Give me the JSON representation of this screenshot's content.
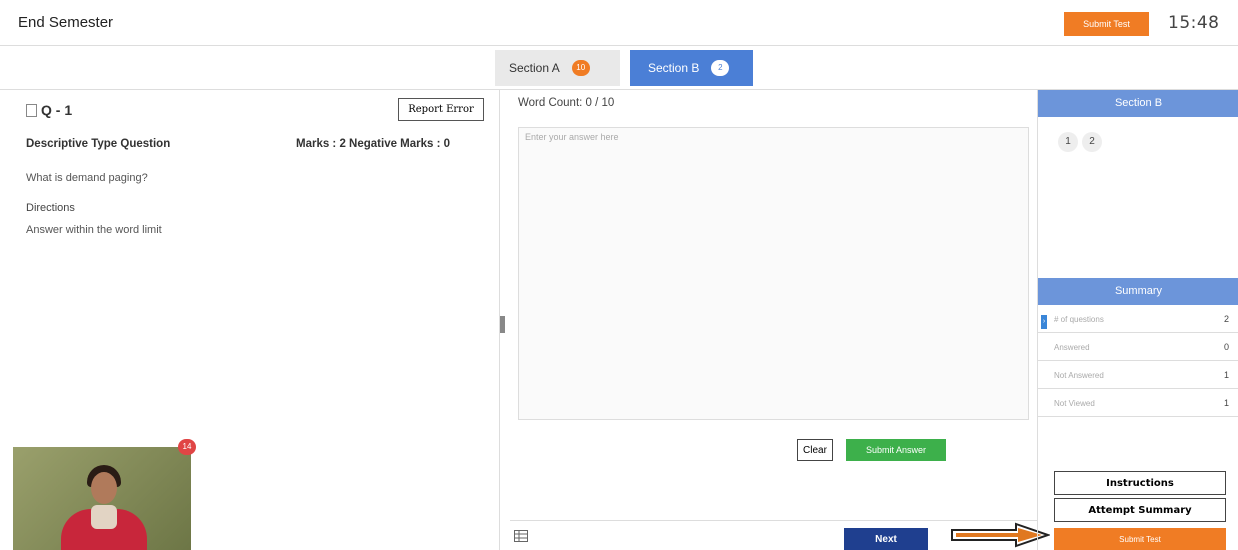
{
  "header": {
    "title": "End Semester",
    "submit_label": "Submit Test",
    "timer": "15:48"
  },
  "tabs": [
    {
      "label": "Section A",
      "badge": "10"
    },
    {
      "label": "Section B",
      "badge": "2"
    }
  ],
  "question": {
    "number": "Q - 1",
    "report_label": "Report Error",
    "type": "Descriptive Type Question",
    "marks": "Marks : 2  Negative Marks : 0",
    "text": "What is demand paging?",
    "directions_title": "Directions",
    "directions_text": "Answer within the word limit"
  },
  "webcam": {
    "badge": "14"
  },
  "answer": {
    "word_count": "Word Count: 0 / 10",
    "placeholder": "Enter your answer here",
    "clear_label": "Clear",
    "submit_label": "Submit Answer",
    "next_label": "Next"
  },
  "side": {
    "section_title": "Section B",
    "question_numbers": [
      "1",
      "2"
    ],
    "summary_title": "Summary",
    "summary": [
      {
        "label": "# of questions",
        "value": "2"
      },
      {
        "label": "Answered",
        "value": "0"
      },
      {
        "label": "Not Answered",
        "value": "1"
      },
      {
        "label": "Not Viewed",
        "value": "1"
      }
    ],
    "instructions_label": "Instructions",
    "attempt_label": "Attempt Summary",
    "submit_label": "Submit Test"
  },
  "colors": {
    "accent_orange": "#f07c24",
    "section_blue": "#4b7fd6",
    "submit_green": "#3db04b",
    "next_navy": "#1f3f8f"
  }
}
